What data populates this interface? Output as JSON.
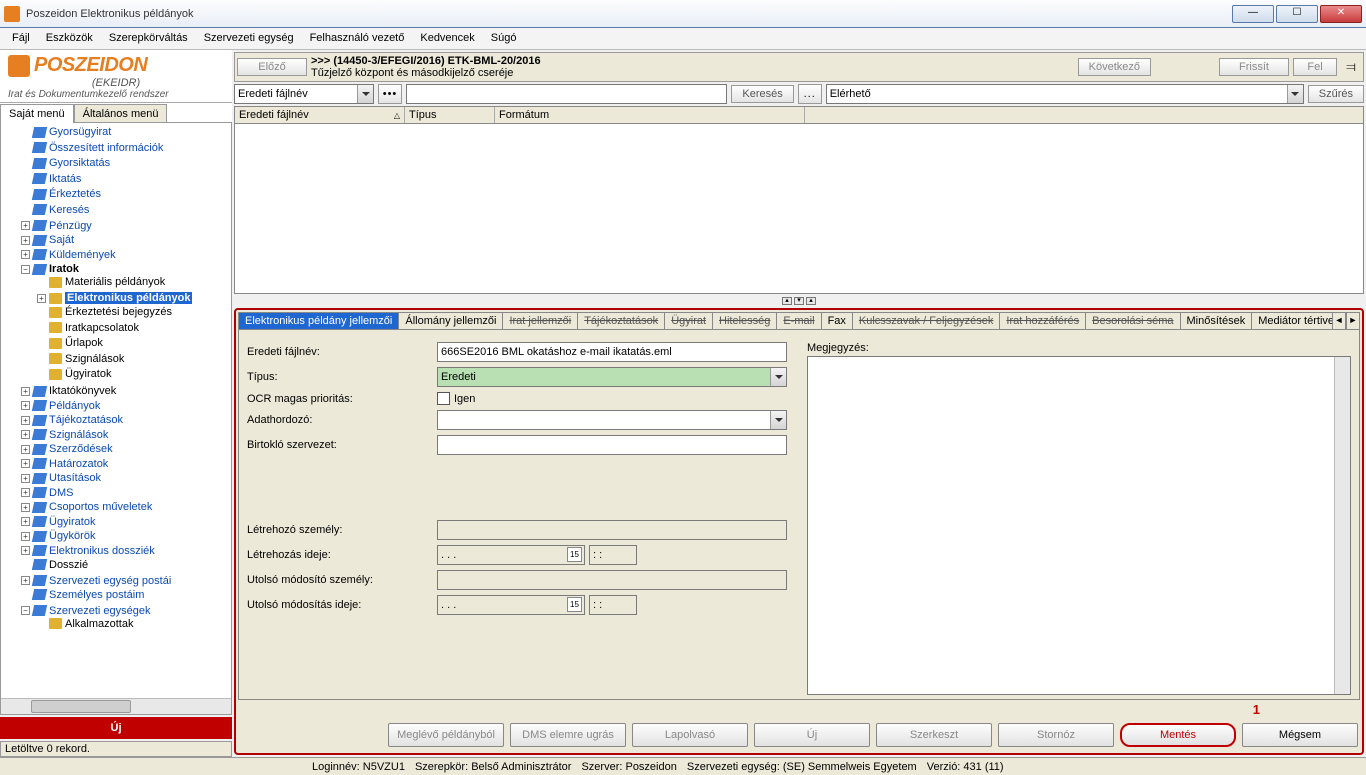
{
  "window": {
    "title": "Poszeidon Elektronikus példányok"
  },
  "menu": [
    "Fájl",
    "Eszközök",
    "Szerepkörváltás",
    "Szervezeti egység",
    "Felhasználó vezető",
    "Kedvencek",
    "Súgó"
  ],
  "logo": {
    "brand": "POSZEIDON",
    "sub1": "(EKEIDR)",
    "sub2": "Irat és Dokumentumkezelő rendszer"
  },
  "sidebarTabs": [
    "Saját menü",
    "Általános menü"
  ],
  "tree": {
    "top": [
      "Gyorsügyirat",
      "Összesített információk",
      "Gyorsiktatás",
      "Iktatás",
      "Érkeztetés",
      "Keresés",
      "Pénzügy",
      "Saját",
      "Küldemények"
    ],
    "iratok": "Iratok",
    "iratokChildren": [
      "Materiális példányok",
      "Elektronikus példányok",
      "Érkeztetési bejegyzés",
      "Iratkapcsolatok",
      "Űrlapok",
      "Szignálások",
      "Ügyiratok"
    ],
    "rest": [
      "Iktatókönyvek",
      "Példányok",
      "Tájékoztatások",
      "Szignálások",
      "Szerződések",
      "Határozatok",
      "Utasítások",
      "DMS",
      "Csoportos műveletek",
      "Ügyiratok",
      "Ügykörök",
      "Elektronikus dossziék",
      "Dosszié",
      "Szervezeti egység postái",
      "Személyes postáim",
      "Szervezeti egységek"
    ],
    "last": "Alkalmazottak"
  },
  "uj": "Új",
  "statusLeft": "Letöltve 0 rekord.",
  "top": {
    "prev": "Előző",
    "next": "Következő",
    "refresh": "Frissít",
    "up": "Fel",
    "line1": ">>> (14450-3/EFEGI/2016) ETK-BML-20/2016",
    "line2": "Tűzjelző központ és másodkijelző cseréje"
  },
  "search": {
    "leftSelect": "Eredeti fájlnév",
    "searchBtn": "Keresés",
    "rightSelect": "Elérhető",
    "filterBtn": "Szűrés"
  },
  "gridCols": [
    "Eredeti fájlnév",
    "Típus",
    "Formátum"
  ],
  "ftabs": [
    "Elektronikus példány jellemzői",
    "Állomány jellemzői",
    "Irat jellemzői",
    "Tájékoztatások",
    "Ügyirat",
    "Hitelesség",
    "E-mail",
    "Fax",
    "Kulcsszavak / Feljegyzések",
    "Irat hozzáférés",
    "Besorolási séma",
    "Minősítések",
    "Mediátor tértivevén"
  ],
  "form": {
    "l_filename": "Eredeti fájlnév:",
    "v_filename": "666SE2016 BML okatáshoz e-mail ikatatás.eml",
    "l_type": "Típus:",
    "v_type": "Eredeti",
    "l_ocr": "OCR magas prioritás:",
    "v_ocr": "Igen",
    "l_media": "Adathordozó:",
    "l_owner": "Birtokló szervezet:",
    "l_creator": "Létrehozó személy:",
    "l_created": "Létrehozás ideje:",
    "v_date": ". . .",
    "v_time": ": :",
    "l_modifier": "Utolsó módosító személy:",
    "l_modified": "Utolsó módosítás ideje:",
    "l_note": "Megjegyzés:"
  },
  "redNum": "1",
  "btns": [
    "Meglévő példányból",
    "DMS elemre ugrás",
    "Lapolvasó",
    "Új",
    "Szerkeszt",
    "Stornóz",
    "Mentés",
    "Mégsem"
  ],
  "status": {
    "login": "Loginnév: N5VZU1",
    "role": "Szerepkör: Belső Adminisztrátor",
    "server": "Szerver: Poszeidon",
    "org": "Szervezeti egység: (SE) Semmelweis Egyetem",
    "ver": "Verzió: 431 (11)"
  }
}
